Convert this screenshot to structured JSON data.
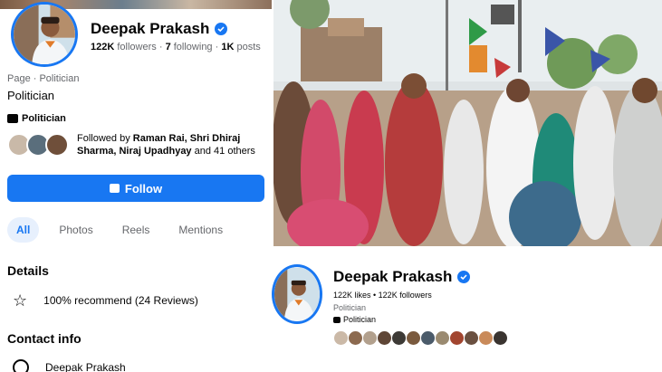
{
  "left": {
    "page_name": "Deepak Prakash",
    "stats": {
      "followers_count": "122K",
      "followers_label": "followers",
      "following_count": "7",
      "following_label": "following",
      "posts_count": "1K",
      "posts_label": "posts"
    },
    "category_line": "Page · Politician",
    "description": "Politician",
    "category_badge": "Politician",
    "followed_by": {
      "prefix": "Followed by",
      "names": "Raman Rai, Shri Dhiraj Sharma, Niraj Upadhyay",
      "suffix": "and 41 others"
    },
    "follow_button": "Follow",
    "tabs": [
      {
        "label": "All",
        "active": true
      },
      {
        "label": "Photos",
        "active": false
      },
      {
        "label": "Reels",
        "active": false
      },
      {
        "label": "Mentions",
        "active": false
      }
    ],
    "details": {
      "title": "Details",
      "recommend": "100% recommend (24 Reviews)"
    },
    "contact": {
      "title": "Contact info",
      "messenger_name": "Deepak Prakash"
    }
  },
  "right_bottom": {
    "page_name": "Deepak Prakash",
    "stats": "122K likes • 122K followers",
    "description": "Politician",
    "category": "Politician",
    "follower_avatar_count": 12
  },
  "icons": {
    "verified": "verified-badge-icon",
    "lock": "lock-icon",
    "star": "star-icon",
    "messenger": "messenger-icon",
    "briefcase": "briefcase-icon"
  },
  "colors": {
    "accent": "#1877f2",
    "text": "#050505",
    "muted": "#65676b",
    "tab_active_bg": "#e7f0fd"
  }
}
